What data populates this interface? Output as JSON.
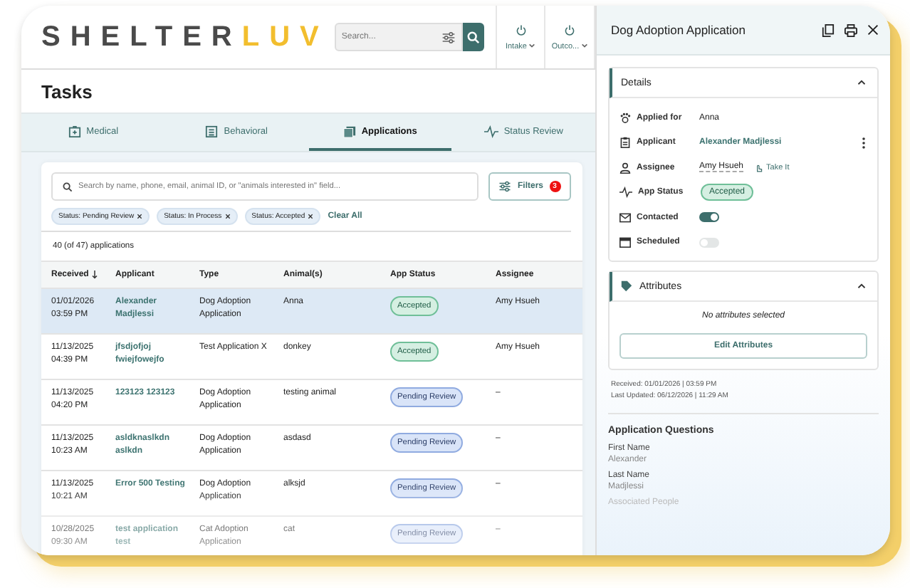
{
  "logo": {
    "part_1": "SHELTER",
    "part_2": "LUV"
  },
  "search": {
    "placeholder": "Search..."
  },
  "nav": [
    {
      "label": "Intake"
    },
    {
      "label": "Outco..."
    }
  ],
  "page_title": "Tasks",
  "tabs": [
    {
      "label": "Medical",
      "selected": false
    },
    {
      "label": "Behavioral",
      "selected": false
    },
    {
      "label": "Applications",
      "selected": true
    },
    {
      "label": "Status Review",
      "selected": false
    }
  ],
  "list_search": {
    "placeholder": "Search by name, phone, email, animal ID, or \"animals interested in\" field..."
  },
  "filters": {
    "label": "Filters",
    "count": "3"
  },
  "chips": [
    "Status: Pending Review",
    "Status: In Process",
    "Status: Accepted"
  ],
  "clear_all": "Clear All",
  "count_text": "40 (of 47) applications",
  "table": {
    "columns": [
      "Received",
      "Applicant",
      "Type",
      "Animal(s)",
      "App Status",
      "Assignee"
    ],
    "rows": [
      {
        "selected": true,
        "received": [
          "01/01/2026",
          "03:59 PM"
        ],
        "applicant": "Alexander Madjlessi",
        "type": "Dog Adoption Application",
        "animal": "Anna",
        "status": "Accepted",
        "kind": "accepted",
        "assignee": "Amy Hsueh"
      },
      {
        "selected": false,
        "received": [
          "11/13/2025",
          "04:39 PM"
        ],
        "applicant": "jfsdjofjoj fwiejfowejfo",
        "type": "Test Application X",
        "animal": "donkey",
        "status": "Accepted",
        "kind": "accepted",
        "assignee": "Amy Hsueh"
      },
      {
        "selected": false,
        "received": [
          "11/13/2025",
          "04:20 PM"
        ],
        "applicant": "123123 123123",
        "type": "Dog Adoption Application",
        "animal": "testing animal",
        "status": "Pending Review",
        "kind": "pending",
        "assignee": "–"
      },
      {
        "selected": false,
        "received": [
          "11/13/2025",
          "10:23 AM"
        ],
        "applicant": "asldknaslkdn aslkdn",
        "type": "Dog Adoption Application",
        "animal": "asdasd",
        "status": "Pending Review",
        "kind": "pending",
        "assignee": "–"
      },
      {
        "selected": false,
        "received": [
          "11/13/2025",
          "10:21 AM"
        ],
        "applicant": "Error 500 Testing",
        "type": "Dog Adoption Application",
        "animal": "alksjd",
        "status": "Pending Review",
        "kind": "pending",
        "assignee": "–"
      },
      {
        "selected": false,
        "received": [
          "10/28/2025",
          "09:30 AM"
        ],
        "applicant": "test application test",
        "type": "Cat Adoption Application",
        "animal": "cat",
        "status": "Pending Review",
        "kind": "pending",
        "assignee": "–"
      }
    ]
  },
  "panel": {
    "title": "Dog Adoption Application",
    "details": {
      "title": "Details",
      "expanded": true,
      "fields": [
        {
          "kind": "text",
          "label": "Applied for",
          "value": "Anna"
        },
        {
          "kind": "link",
          "label": "Applicant",
          "value": "Alexander Madjlessi"
        },
        {
          "kind": "assignee",
          "label": "Assignee",
          "value": "Amy Hsueh",
          "action": "Take It"
        },
        {
          "kind": "status",
          "label": "App Status",
          "value": "Accepted"
        },
        {
          "kind": "toggle",
          "label": "Contacted",
          "on": true
        },
        {
          "kind": "toggle",
          "label": "Scheduled",
          "on": false
        }
      ]
    },
    "attributes": {
      "title": "Attributes",
      "expanded": true,
      "empty_text": "No attributes selected",
      "button": "Edit Attributes"
    },
    "received": "Received: 01/01/2026 | 03:59 PM",
    "updated": "Last Updated: 06/12/2026 | 11:29 AM",
    "questions_title": "Application Questions",
    "questions": [
      {
        "label": "First Name",
        "value": "Alexander"
      },
      {
        "label": "Last Name",
        "value": "Madjlessi"
      },
      {
        "label": "Associated People"
      }
    ]
  }
}
